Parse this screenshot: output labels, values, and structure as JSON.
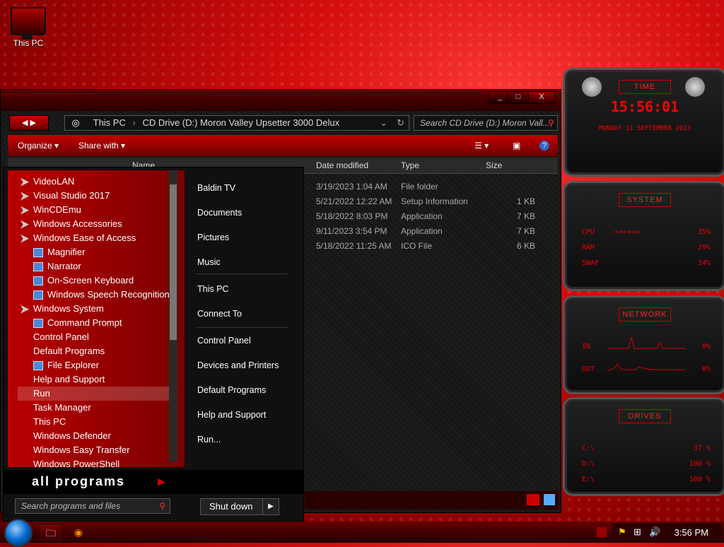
{
  "desktop": {
    "icon_label": "This PC"
  },
  "window": {
    "controls": {
      "minimize": "_",
      "maximize": "□",
      "close": "X"
    },
    "nav": {
      "back": "◀",
      "forward": "▶"
    },
    "address": {
      "crumb1": "This PC",
      "crumb2": "CD Drive (D:) Moron Valley Upsetter 3000 Delux"
    },
    "search_placeholder": "Search CD Drive (D:) Moron Vall...",
    "toolbar": {
      "organize": "Organize",
      "share": "Share with"
    },
    "columns": {
      "name": "Name",
      "date": "Date modified",
      "type": "Type",
      "size": "Size"
    },
    "rows": [
      {
        "date": "3/19/2023 1:04 AM",
        "type": "File folder",
        "size": ""
      },
      {
        "date": "5/21/2022 12:22 AM",
        "type": "Setup Information",
        "size": "1 KB"
      },
      {
        "date": "5/18/2022 8:03 PM",
        "type": "Application",
        "size": "7 KB"
      },
      {
        "date": "9/11/2023 3:54 PM",
        "type": "Application",
        "size": "7 KB"
      },
      {
        "date": "5/18/2022 11:25 AM",
        "type": "ICO File",
        "size": "6 KB"
      }
    ]
  },
  "start_menu": {
    "programs": [
      {
        "label": "VideoLAN",
        "indent": 0,
        "icon": "vs"
      },
      {
        "label": "Visual Studio 2017",
        "indent": 0,
        "icon": "vs"
      },
      {
        "label": "WinCDEmu",
        "indent": 0,
        "icon": "vs"
      },
      {
        "label": "Windows Accessories",
        "indent": 0,
        "icon": "vs"
      },
      {
        "label": "Windows Ease of Access",
        "indent": 0,
        "icon": "vs"
      },
      {
        "label": "Magnifier",
        "indent": 1,
        "icon": "app"
      },
      {
        "label": "Narrator",
        "indent": 1,
        "icon": "app"
      },
      {
        "label": "On-Screen Keyboard",
        "indent": 1,
        "icon": "app"
      },
      {
        "label": "Windows Speech Recognition",
        "indent": 1,
        "icon": "app"
      },
      {
        "label": "Windows System",
        "indent": 0,
        "icon": "vs"
      },
      {
        "label": "Command Prompt",
        "indent": 1,
        "icon": "app"
      },
      {
        "label": "Control Panel",
        "indent": 1,
        "icon": "none"
      },
      {
        "label": "Default Programs",
        "indent": 1,
        "icon": "none"
      },
      {
        "label": "File Explorer",
        "indent": 1,
        "icon": "app"
      },
      {
        "label": "Help and Support",
        "indent": 1,
        "icon": "none"
      },
      {
        "label": "Run",
        "indent": 1,
        "icon": "none"
      },
      {
        "label": "Task Manager",
        "indent": 1,
        "icon": "none"
      },
      {
        "label": "This PC",
        "indent": 1,
        "icon": "none"
      },
      {
        "label": "Windows Defender",
        "indent": 1,
        "icon": "none"
      },
      {
        "label": "Windows Easy Transfer",
        "indent": 1,
        "icon": "none"
      },
      {
        "label": "Windows PowerShell",
        "indent": 1,
        "icon": "none"
      }
    ],
    "right_items": [
      "Baldin TV",
      "Documents",
      "Pictures",
      "Music",
      "This PC",
      "Connect To",
      "Control Panel",
      "Devices and Printers",
      "Default Programs",
      "Help and Support",
      "Run..."
    ],
    "all_programs": "all programs",
    "search_placeholder": "Search programs and files",
    "shutdown": "Shut down"
  },
  "gadgets": {
    "time": {
      "title": "TIME",
      "clock": "15:56:01",
      "date": "MONDAY 11 SEPTEMBER 2023"
    },
    "system": {
      "title": "SYSTEM",
      "cpu_label": "CPU",
      "cpu": "35%",
      "ram_label": "RAM",
      "ram": "29%",
      "swap_label": "SWAP",
      "swap": "24%"
    },
    "network": {
      "title": "NETWORK",
      "in_label": "IN",
      "in": "0%",
      "out_label": "OUT",
      "out": "0%"
    },
    "drives": {
      "title": "DRIVES",
      "c_label": "C:\\",
      "c": "37 %",
      "d_label": "D:\\",
      "d": "100 %",
      "e_label": "E:\\",
      "e": "100 %"
    }
  },
  "taskbar": {
    "clock": "3:56 PM"
  }
}
